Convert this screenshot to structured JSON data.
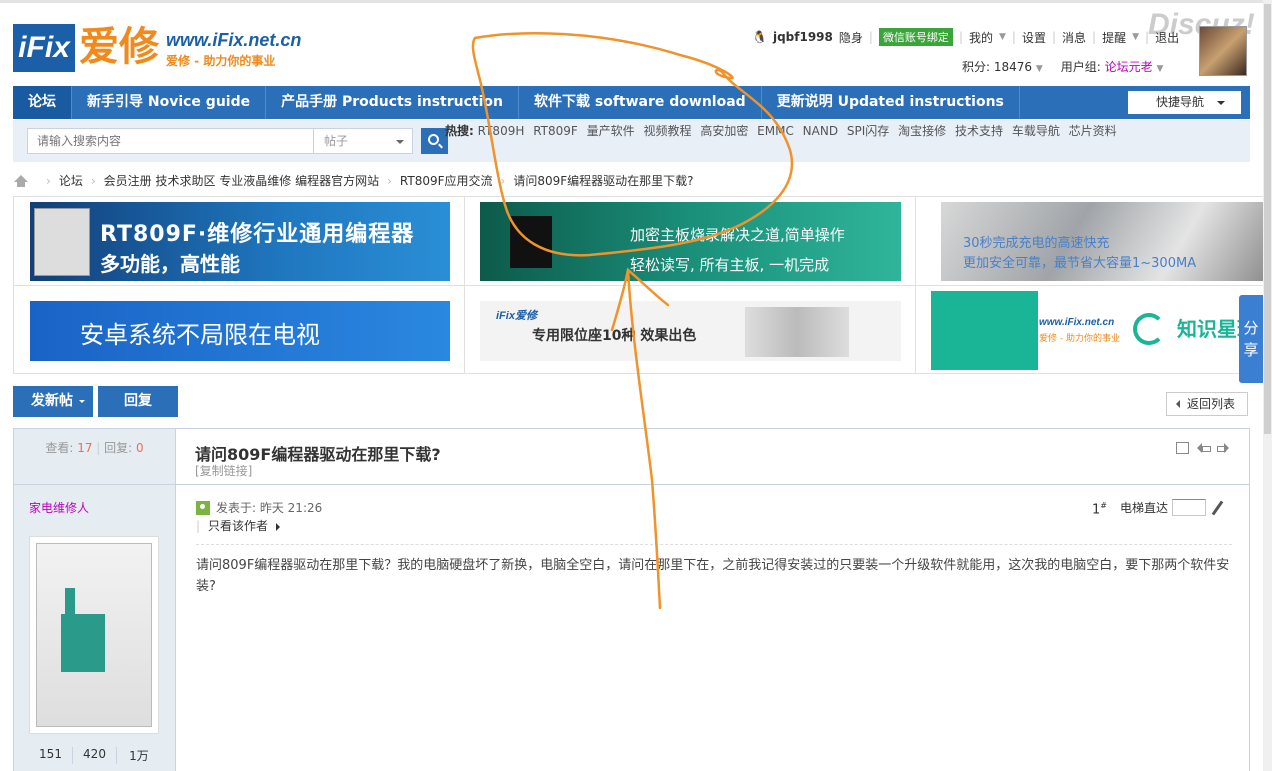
{
  "brand": {
    "logo_text": "iFix",
    "logo_cn": "爱修",
    "url": "www.iFix.net.cn",
    "slogan": "爱修 - 助力你的事业",
    "watermark": "Discuz!"
  },
  "user": {
    "name": "jqbf1998",
    "status": "隐身",
    "wechat": "微信账号绑定",
    "links": [
      "我的",
      "设置",
      "消息",
      "提醒",
      "退出"
    ],
    "points_label": "积分: 18476",
    "group_label": "用户组:",
    "group_value": "论坛元老"
  },
  "nav": {
    "items": [
      "论坛",
      "新手引导 Novice guide",
      "产品手册 Products instruction",
      "软件下载 software download",
      "更新说明 Updated instructions"
    ],
    "quick_nav": "快捷导航"
  },
  "search": {
    "placeholder": "请输入搜索内容",
    "type": "帖子",
    "hot_label": "热搜:",
    "hot_words": [
      "RT809H",
      "RT809F",
      "量产软件",
      "视频教程",
      "高安加密",
      "EMMC",
      "NAND",
      "SPI闪存",
      "淘宝接修",
      "技术支持",
      "车载导航",
      "芯片资料"
    ]
  },
  "breadcrumb": [
    "论坛",
    "会员注册 技术求助区 专业液晶维修 编程器官方网站",
    "RT809F应用交流",
    "请问809F编程器驱动在那里下载?"
  ],
  "banners": {
    "b1_line1": "RT809F·维修行业通用编程器",
    "b1_line2": "多功能，高性能",
    "b2_line1": "加密主板烧录解决之道,简单操作",
    "b2_line2": "轻松读写, 所有主板, 一机完成",
    "b3_line1": "30秒完成充电的高速快充",
    "b3_line2": "更加安全可靠，最节省大容量1~300MA",
    "b4_line1": "安卓系统不局限在电视",
    "b5_brand": "iFix爱修",
    "b5_line1": "专用限位座10种 效果出色",
    "b6_url": "www.iFix.net.cn",
    "b6_slogan": "爱修 - 助力你的事业",
    "b6_line1": "知识星球"
  },
  "share": "分享",
  "actions": {
    "new_post": "发新帖",
    "reply": "回复",
    "back": "返回列表"
  },
  "thread": {
    "views_label": "查看:",
    "views": "17",
    "replies_label": "回复:",
    "replies": "0",
    "title": "请问809F编程器驱动在那里下载?",
    "copy_link": "[复制链接]",
    "author": "家电维修人",
    "author_counts": [
      "151",
      "420",
      "1万"
    ],
    "posted": "发表于: 昨天 21:26",
    "only_author": "只看该作者",
    "floor": "1",
    "floor_sup": "#",
    "elevator": "电梯直达",
    "body": "请问809F编程器驱动在那里下载？我的电脑硬盘坏了新换，电脑全空白，请问在那里下在，之前我记得安装过的只要装一个升级软件就能用，这次我的电脑空白，要下那两个软件安装?"
  },
  "colors": {
    "nav_blue": "#2b6fb9",
    "accent_orange": "#f08a1c",
    "scribble": "#f0932b"
  }
}
